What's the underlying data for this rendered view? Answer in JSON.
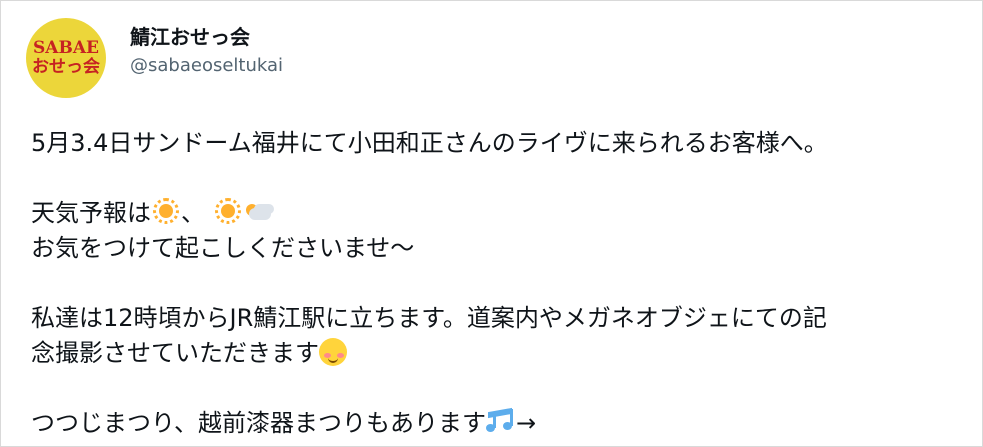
{
  "account": {
    "display_name": "鯖江おせっ会",
    "handle": "@sabaeoseltukai",
    "avatar_text_1": "SABAE",
    "avatar_text_2": "おせっ会"
  },
  "tweet": {
    "line1": "5月3.4日サンドーム福井にて小田和正さんのライヴに来られるお客様へ。",
    "line2_text": "天気予報は",
    "line2_sep": "、",
    "line3": "お気をつけて起こしくださいませ～",
    "line4": "私達は12時頃からJR鯖江駅に立ちます。道案内やメガネオブジェにての記",
    "line5_text": "念撮影させていただきます",
    "line6_text": "つつじまつり、越前漆器まつりもあります",
    "line6_tail": "→"
  },
  "icons": {
    "sun": "sun-icon",
    "sun_behind_cloud": "sun-behind-cloud-icon",
    "blush_face": "smiling-face-icon",
    "music_notes": "music-notes-icon"
  },
  "colors": {
    "text": "#0f1419",
    "handle": "#536471",
    "avatar_bg": "#ecd63a",
    "avatar_text": "#c62222"
  }
}
